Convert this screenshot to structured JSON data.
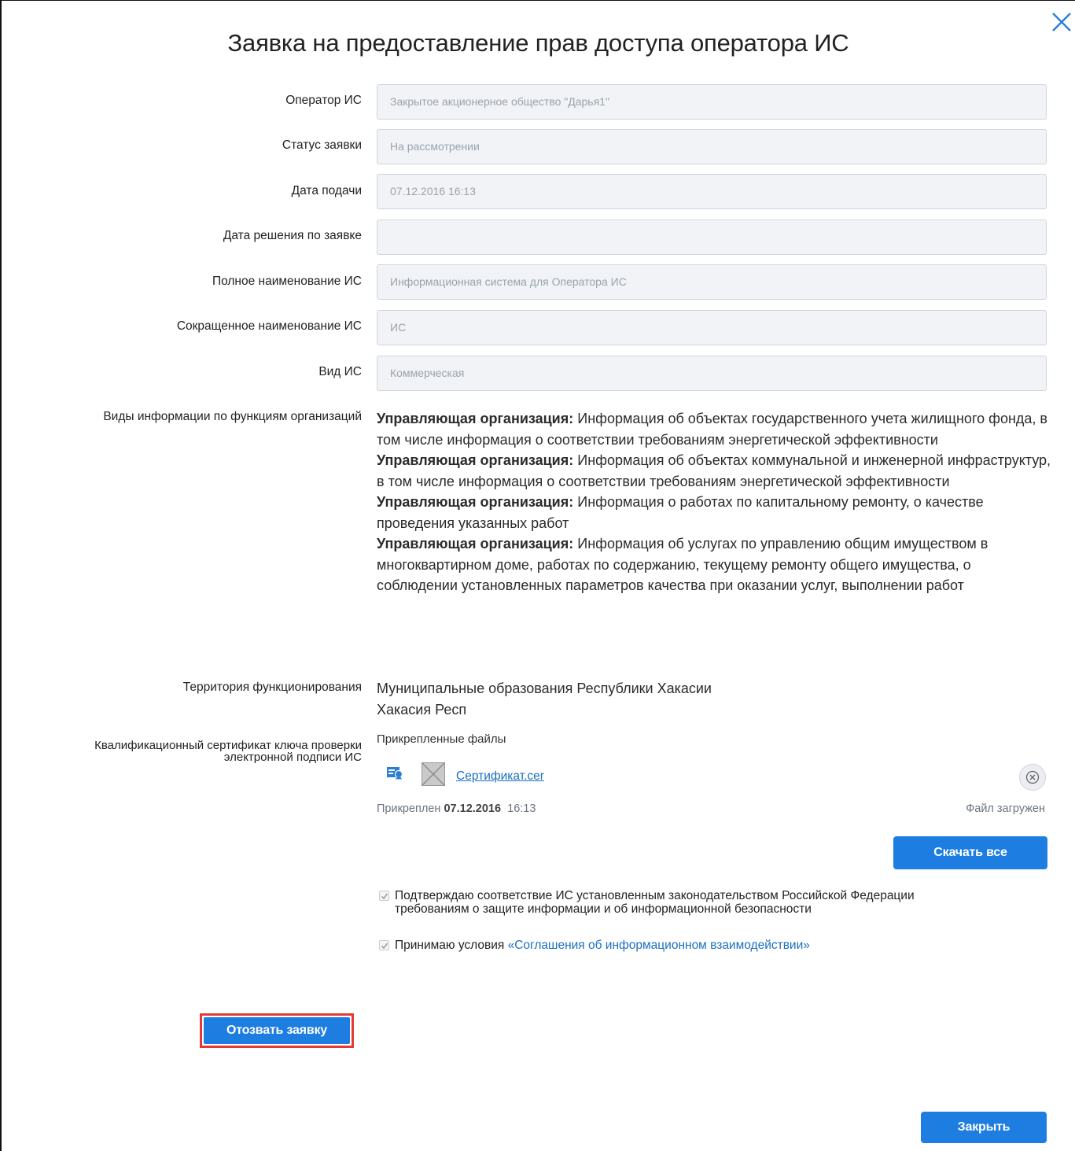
{
  "dialog": {
    "title": "Заявка на предоставление прав доступа оператора ИС"
  },
  "fields": [
    {
      "label": "Оператор ИС",
      "value": "Закрытое акционерное общество \"Дарья1\""
    },
    {
      "label": "Статус заявки",
      "value": "На рассмотрении"
    },
    {
      "label": "Дата подачи",
      "value": "07.12.2016 16:13"
    },
    {
      "label": "Дата решения по заявке",
      "value": ""
    },
    {
      "label": "Полное наименование ИС",
      "value": "Информационная система для Оператора ИС"
    },
    {
      "label": "Сокращенное наименование ИС",
      "value": "ИС"
    },
    {
      "label": "Вид ИС",
      "value": "Коммерческая"
    }
  ],
  "info_types": {
    "label": "Виды информации по функциям организаций",
    "items": [
      {
        "role": "Управляющая организация:",
        "text": "Информация об объектах государственного учета жилищного фонда, в том числе информация о соответствии требованиям энергетической эффективности"
      },
      {
        "role": "Управляющая организация:",
        "text": "Информация об объектах коммунальной и инженерной инфраструктур, в том числе информация о соответствии требованиям энергетической эффективности"
      },
      {
        "role": "Управляющая организация:",
        "text": "Информация о работах по капитальному ремонту, о качестве проведения указанных работ"
      },
      {
        "role": "Управляющая организация:",
        "text": "Информация об услугах по управлению общим имуществом в многоквартирном доме, работах по содержанию, текущему ремонту общего имущества, о соблюдении установленных параметров качества при оказании услуг, выполнении работ"
      }
    ]
  },
  "territory": {
    "label": "Территория функционирования",
    "line1": "Муниципальные образования Республики Хакасии",
    "line2": "Хакасия Респ"
  },
  "certificate": {
    "label_line1": "Квалификационный сертификат ключа проверки",
    "label_line2": "электронной подписи ИС",
    "attached_title": "Прикрепленные файлы",
    "file_name": "Сертификат.cer",
    "attached_prefix": "Прикреплен",
    "attached_date": "07.12.2016",
    "attached_time": "16:13",
    "status": "Файл загружен",
    "icons": [
      "certificate-icon",
      "image-placeholder-icon",
      "remove-circle-icon"
    ]
  },
  "buttons": {
    "download_all": "Скачать все",
    "withdraw": "Отозвать заявку",
    "close": "Закрыть"
  },
  "checkboxes": {
    "compliance_line1": "Подтверждаю соответствие ИС установленным законодательством Российской Федерации",
    "compliance_line2": "требованиям о защите информации и об информационной безопасности",
    "compliance_checked": true,
    "terms_prefix": "Принимаю условия",
    "terms_link": "«Соглашения об информационном взаимодействии»",
    "terms_checked": true
  },
  "colors": {
    "primary": "#1d7de0",
    "link": "#1b6fc2",
    "highlight": "#e53935",
    "input_bg": "#f1f3f6"
  }
}
